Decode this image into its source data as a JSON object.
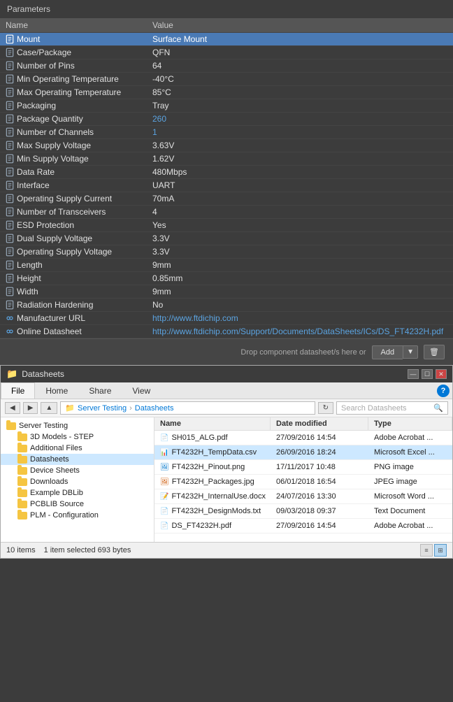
{
  "params": {
    "title": "Parameters",
    "columns": {
      "name": "Name",
      "value": "Value"
    },
    "rows": [
      {
        "name": "Mount",
        "value": "Surface Mount",
        "icon": "doc",
        "selected": true,
        "link": false
      },
      {
        "name": "Case/Package",
        "value": "QFN",
        "icon": "doc",
        "selected": false,
        "link": false
      },
      {
        "name": "Number of Pins",
        "value": "64",
        "icon": "doc",
        "selected": false,
        "link": false
      },
      {
        "name": "Min Operating Temperature",
        "value": "-40°C",
        "icon": "doc",
        "selected": false,
        "link": false
      },
      {
        "name": "Max Operating Temperature",
        "value": "85°C",
        "icon": "doc",
        "selected": false,
        "link": false
      },
      {
        "name": "Packaging",
        "value": "Tray",
        "icon": "doc",
        "selected": false,
        "link": false
      },
      {
        "name": "Package Quantity",
        "value": "260",
        "icon": "doc",
        "selected": false,
        "link": false,
        "valueColor": "accent"
      },
      {
        "name": "Number of Channels",
        "value": "1",
        "icon": "doc",
        "selected": false,
        "link": false,
        "valueColor": "accent"
      },
      {
        "name": "Max Supply Voltage",
        "value": "3.63V",
        "icon": "doc",
        "selected": false,
        "link": false
      },
      {
        "name": "Min Supply Voltage",
        "value": "1.62V",
        "icon": "doc",
        "selected": false,
        "link": false
      },
      {
        "name": "Data Rate",
        "value": "480Mbps",
        "icon": "doc",
        "selected": false,
        "link": false
      },
      {
        "name": "Interface",
        "value": "UART",
        "icon": "doc",
        "selected": false,
        "link": false
      },
      {
        "name": "Operating Supply Current",
        "value": "70mA",
        "icon": "doc",
        "selected": false,
        "link": false
      },
      {
        "name": "Number of Transceivers",
        "value": "4",
        "icon": "doc",
        "selected": false,
        "link": false
      },
      {
        "name": "ESD Protection",
        "value": "Yes",
        "icon": "doc",
        "selected": false,
        "link": false
      },
      {
        "name": "Dual Supply Voltage",
        "value": "3.3V",
        "icon": "doc",
        "selected": false,
        "link": false
      },
      {
        "name": "Operating Supply Voltage",
        "value": "3.3V",
        "icon": "doc",
        "selected": false,
        "link": false
      },
      {
        "name": "Length",
        "value": "9mm",
        "icon": "doc",
        "selected": false,
        "link": false
      },
      {
        "name": "Height",
        "value": "0.85mm",
        "icon": "doc",
        "selected": false,
        "link": false
      },
      {
        "name": "Width",
        "value": "9mm",
        "icon": "doc",
        "selected": false,
        "link": false
      },
      {
        "name": "Radiation Hardening",
        "value": "No",
        "icon": "doc",
        "selected": false,
        "link": false
      },
      {
        "name": "Manufacturer URL",
        "value": "http://www.ftdichip.com",
        "icon": "link",
        "selected": false,
        "link": true
      },
      {
        "name": "Online Datasheet",
        "value": "http://www.ftdichip.com/Support/Documents/DataSheets/ICs/DS_FT4232H.pdf",
        "icon": "link",
        "selected": false,
        "link": true
      }
    ]
  },
  "dropzone": {
    "text": "Drop component datasheet/s here or",
    "add_label": "Add",
    "delete_icon": "🗑"
  },
  "explorer": {
    "title": "Datasheets",
    "win_min": "—",
    "win_max": "☐",
    "win_close": "✕",
    "tabs": [
      {
        "label": "File",
        "active": true
      },
      {
        "label": "Home",
        "active": false
      },
      {
        "label": "Share",
        "active": false
      },
      {
        "label": "View",
        "active": false
      }
    ],
    "address": {
      "back": "←",
      "forward": "→",
      "up": "↑",
      "path_parts": [
        "Server Testing",
        "Datasheets"
      ],
      "search_placeholder": "Search Datasheets"
    },
    "tree": [
      {
        "label": "Server Testing",
        "indent": 0,
        "open": true
      },
      {
        "label": "3D Models - STEP",
        "indent": 1,
        "open": false
      },
      {
        "label": "Additional Files",
        "indent": 1,
        "open": false
      },
      {
        "label": "Datasheets",
        "indent": 1,
        "open": false,
        "selected": true
      },
      {
        "label": "Device Sheets",
        "indent": 1,
        "open": false
      },
      {
        "label": "Downloads",
        "indent": 1,
        "open": false
      },
      {
        "label": "Example DBLib",
        "indent": 1,
        "open": false
      },
      {
        "label": "PCBLIB Source",
        "indent": 1,
        "open": false
      },
      {
        "label": "PLM - Configuration",
        "indent": 1,
        "open": false
      }
    ],
    "file_columns": [
      "Name",
      "Date modified",
      "Type"
    ],
    "files": [
      {
        "name": "SH015_ALG.pdf",
        "date": "27/09/2016 14:54",
        "type": "Adobe Acrobat ...",
        "ext": "pdf",
        "selected": false,
        "partial": true
      },
      {
        "name": "FT4232H_TempData.csv",
        "date": "26/09/2016 18:24",
        "type": "Microsoft Excel ...",
        "ext": "csv",
        "selected": true
      },
      {
        "name": "FT4232H_Pinout.png",
        "date": "17/11/2017 10:48",
        "type": "PNG image",
        "ext": "png",
        "selected": false
      },
      {
        "name": "FT4232H_Packages.jpg",
        "date": "06/01/2018 16:54",
        "type": "JPEG image",
        "ext": "jpg",
        "selected": false
      },
      {
        "name": "FT4232H_InternalUse.docx",
        "date": "24/07/2016 13:30",
        "type": "Microsoft Word ...",
        "ext": "docx",
        "selected": false
      },
      {
        "name": "FT4232H_DesignMods.txt",
        "date": "09/03/2018 09:37",
        "type": "Text Document",
        "ext": "txt",
        "selected": false
      },
      {
        "name": "DS_FT4232H.pdf",
        "date": "27/09/2016 14:54",
        "type": "Adobe Acrobat ...",
        "ext": "pdf",
        "selected": false
      }
    ],
    "status": {
      "item_count": "10 items",
      "selection": "1 item selected",
      "size": "693 bytes"
    }
  }
}
